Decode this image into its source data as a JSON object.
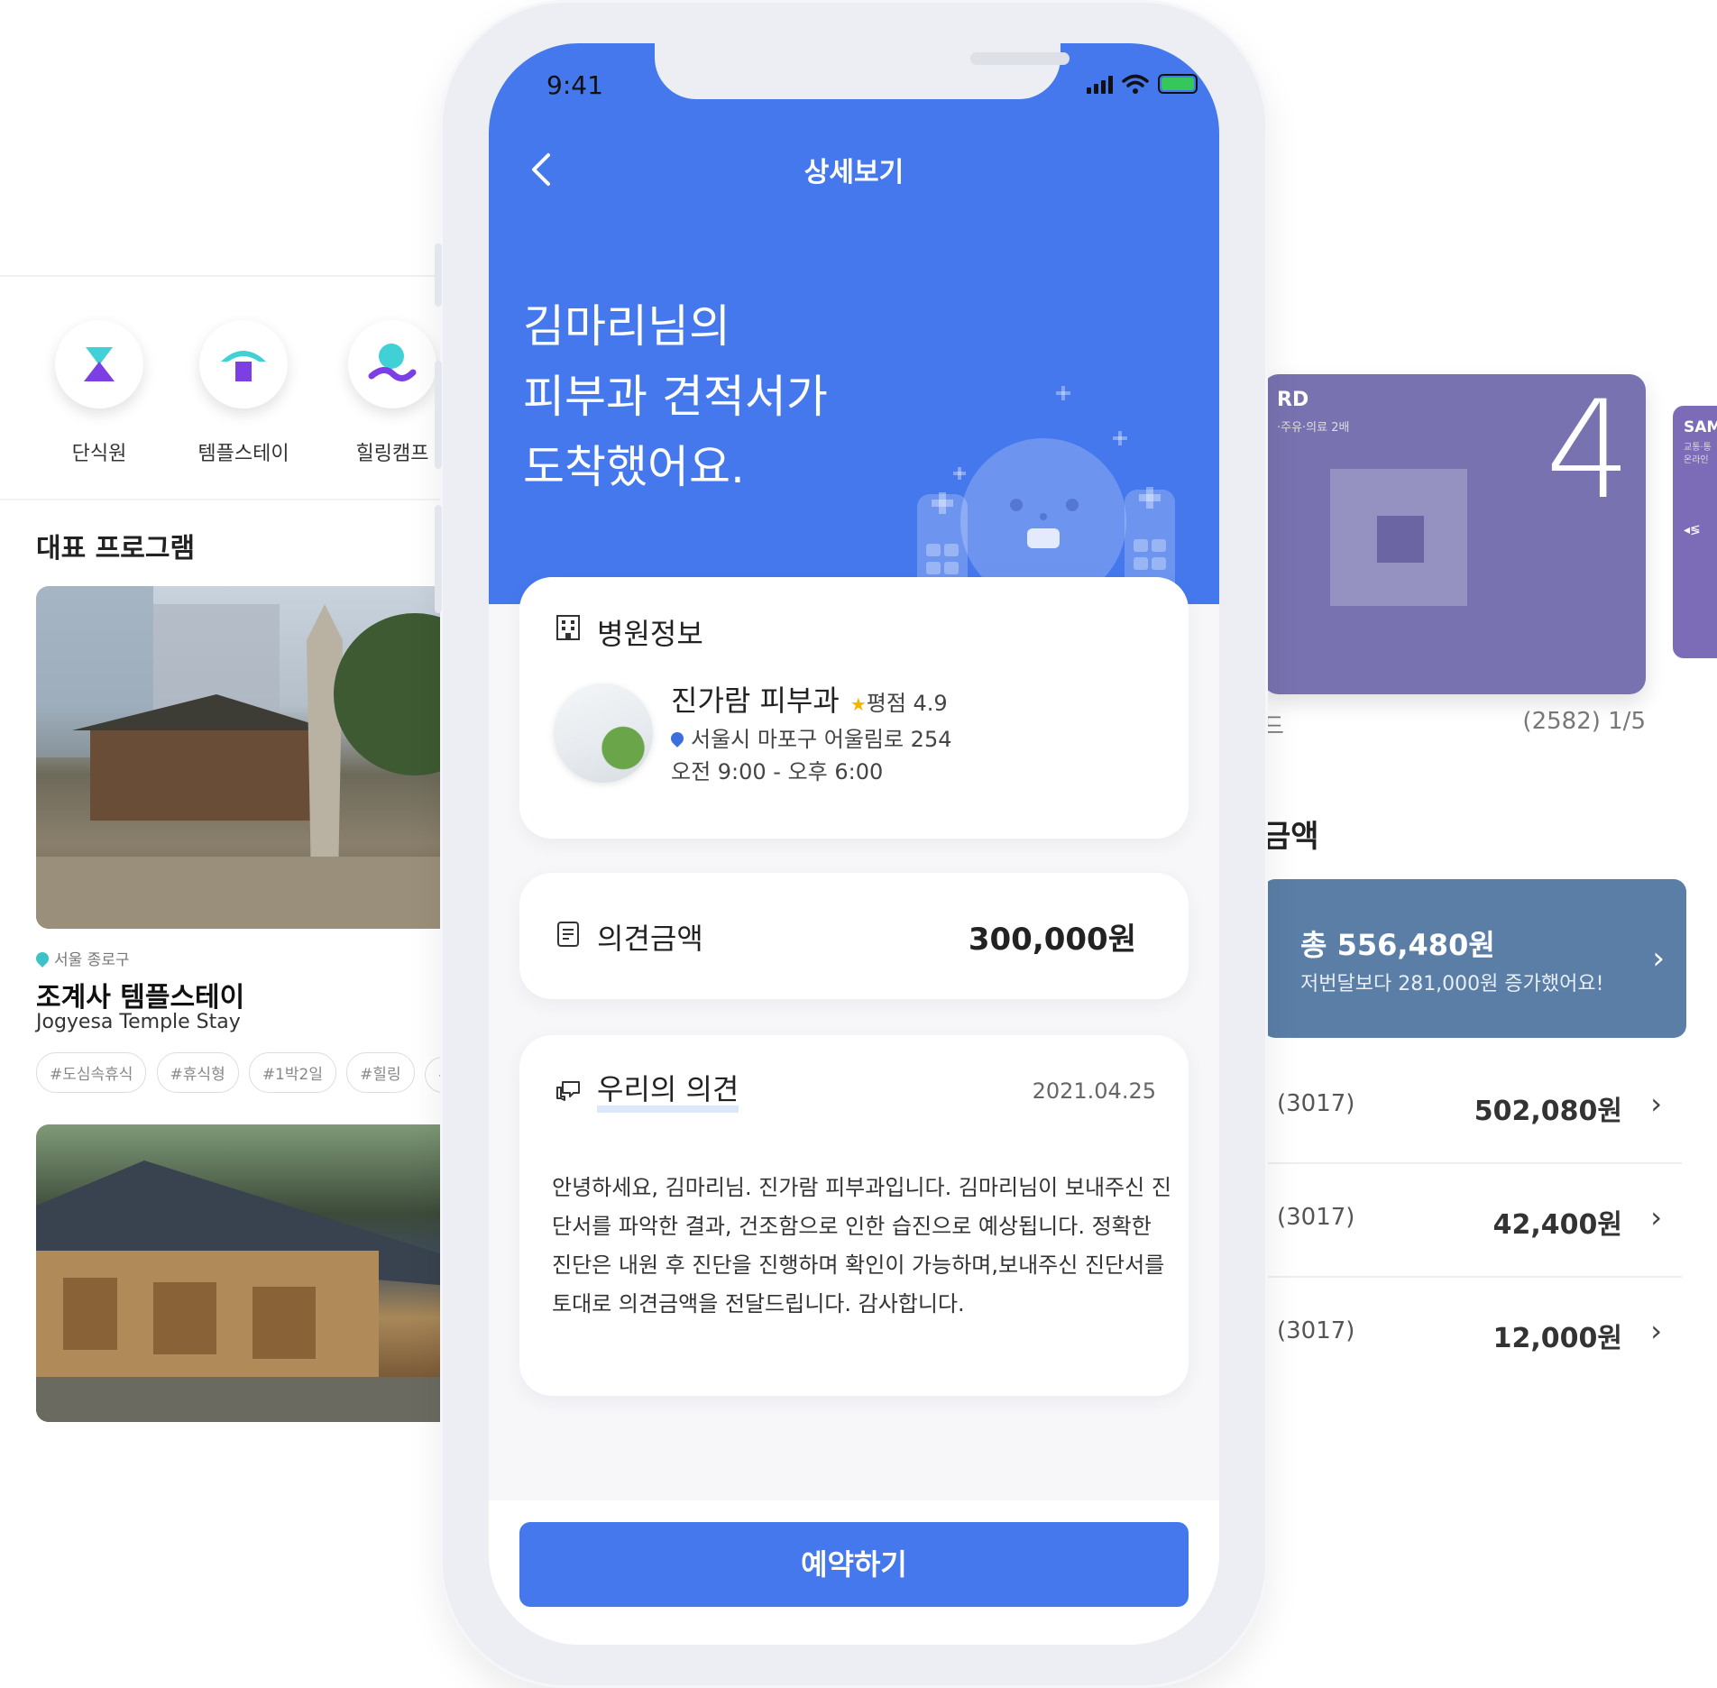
{
  "left_app": {
    "categories": [
      {
        "label": "단식원",
        "icon": "hourglass-icon"
      },
      {
        "label": "템플스테이",
        "icon": "temple-icon"
      },
      {
        "label": "힐링캠프",
        "icon": "person-icon"
      }
    ],
    "section_title": "대표 프로그램",
    "program": {
      "location": "서울 종로구",
      "title": "조계사 템플스테이",
      "subtitle": "Jogyesa Temple Stay",
      "tags": [
        "#도심속휴식",
        "#휴식형",
        "#1박2일",
        "#힐링",
        "#"
      ]
    }
  },
  "right_app": {
    "card": {
      "name": "RD",
      "sub": "·주유·의료 2배",
      "number": "4"
    },
    "card_small": {
      "name": "SAM",
      "sub1": "교통·통",
      "sub2": "온라인",
      "sub3": "◂≶"
    },
    "card_meta_left": "드",
    "card_meta_right": "(2582) 1/5",
    "amount_title": "금액",
    "total": {
      "label": "총 556,480원",
      "desc": "저번달보다 281,000원 증가했어요!",
      "chevron": "›"
    },
    "rows": [
      {
        "code": "(3017)",
        "amount": "502,080원"
      },
      {
        "code": "(3017)",
        "amount": "42,400원"
      },
      {
        "code": "(3017)",
        "amount": "12,000원"
      }
    ]
  },
  "phone": {
    "status": {
      "time": "9:41"
    },
    "nav": {
      "title": "상세보기"
    },
    "headline": [
      "김마리님의",
      "피부과 견적서가",
      "도착했어요."
    ],
    "hospital": {
      "section_title": "병원정보",
      "name": "진가람 피부과",
      "star": "★",
      "rating": "평점 4.9",
      "address": "서울시 마포구 어울림로 254",
      "hours": "오전 9:00 - 오후 6:00"
    },
    "estimate": {
      "label": "의견금액",
      "price": "300,000원"
    },
    "opinion": {
      "title": "우리의 의견",
      "date": "2021.04.25",
      "body": "안녕하세요, 김마리님. 진가람 피부과입니다. 김마리님이 보내주신 진단서를 파악한 결과, 건조함으로 인한 습진으로 예상됩니다. 정확한 진단은 내원 후 진단을 진행하며 확인이 가능하며,보내주신 진단서를 토대로 의견금액을 전달드립니다. 감사합니다."
    },
    "cta": "예약하기"
  },
  "colors": {
    "primary": "#4578ec",
    "card_purple": "#7872b0",
    "total_blue": "#5a7ea6"
  }
}
